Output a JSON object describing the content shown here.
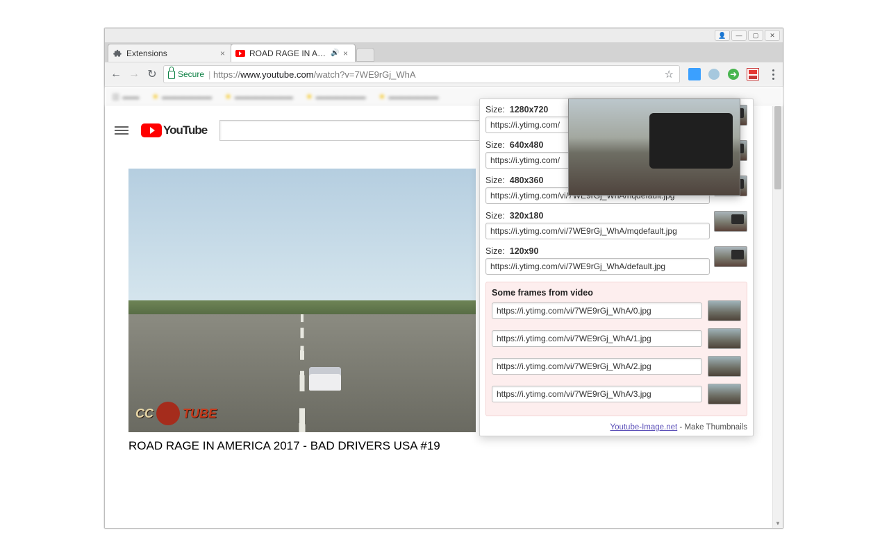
{
  "window_controls": {
    "user": "👤",
    "min": "—",
    "max": "▢",
    "close": "✕"
  },
  "tabs": [
    {
      "label": "Extensions",
      "favicon": "puzzle",
      "active": false,
      "audio": false
    },
    {
      "label": "ROAD RAGE IN AMER",
      "favicon": "youtube",
      "active": true,
      "audio": true
    }
  ],
  "nav": {
    "back": "←",
    "forward": "→",
    "reload": "↻",
    "secure_label": "Secure",
    "url_prefix": "https://",
    "url_host": "www.youtube.com",
    "url_path": "/watch?v=7WE9rGj_WhA"
  },
  "youtube": {
    "brand": "YouTube",
    "search_placeholder": "",
    "video_title": "ROAD RAGE IN AMERICA 2017 - BAD DRIVERS USA #19",
    "cc": "CC",
    "tube": "TUBE"
  },
  "popup": {
    "size_label": "Size:",
    "thumbnails": [
      {
        "dim": "1280x720",
        "url": "https://i.ytimg.com/"
      },
      {
        "dim": "640x480",
        "url": "https://i.ytimg.com/"
      },
      {
        "dim": "480x360",
        "url": "https://i.ytimg.com/vi/7WE9rGj_WhA/hqdefault.jpg"
      },
      {
        "dim": "320x180",
        "url": "https://i.ytimg.com/vi/7WE9rGj_WhA/mqdefault.jpg"
      },
      {
        "dim": "120x90",
        "url": "https://i.ytimg.com/vi/7WE9rGj_WhA/default.jpg"
      }
    ],
    "frames_title": "Some frames from video",
    "frames": [
      {
        "url": "https://i.ytimg.com/vi/7WE9rGj_WhA/0.jpg"
      },
      {
        "url": "https://i.ytimg.com/vi/7WE9rGj_WhA/1.jpg"
      },
      {
        "url": "https://i.ytimg.com/vi/7WE9rGj_WhA/2.jpg"
      },
      {
        "url": "https://i.ytimg.com/vi/7WE9rGj_WhA/3.jpg"
      }
    ],
    "footer_link": "Youtube-Image.net",
    "footer_rest": " - Make Thumbnails"
  }
}
